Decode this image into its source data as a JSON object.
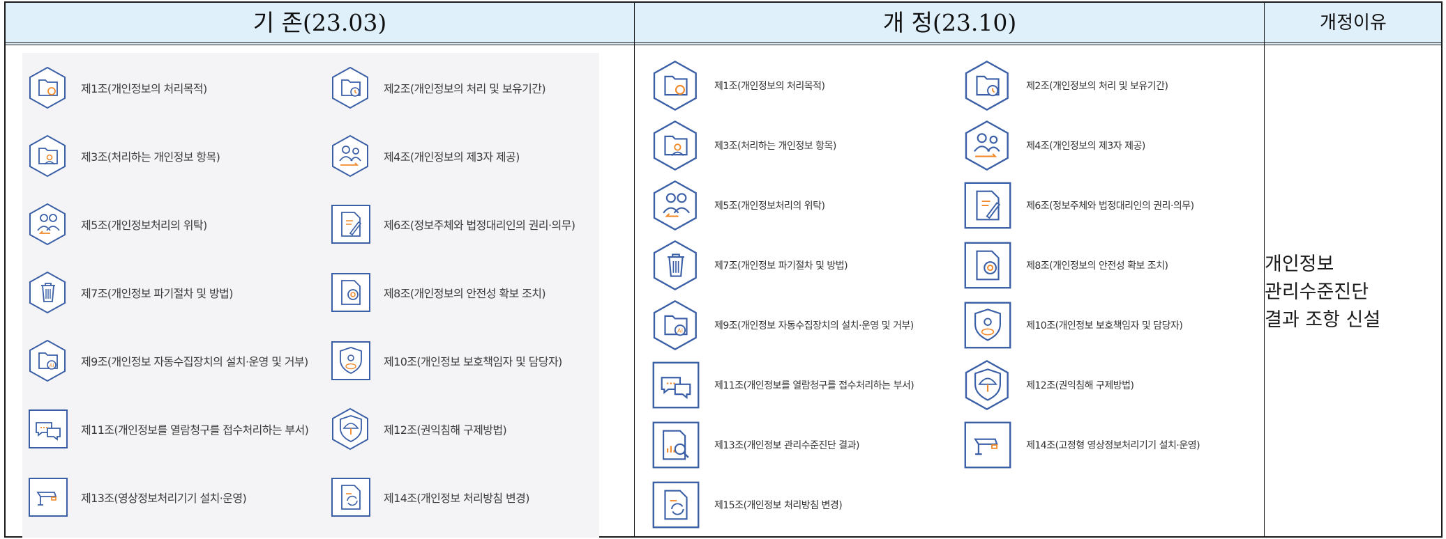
{
  "header": {
    "col_old": "기  존(23.03)",
    "col_new": "개  정(23.10)",
    "col_reason": "개정이유"
  },
  "old_items": [
    {
      "label": "제1조(개인정보의 처리목적)",
      "icon": "folder-gear-icon",
      "frame": "hex"
    },
    {
      "label": "제2조(개인정보의 처리 및 보유기간)",
      "icon": "folder-clock-icon",
      "frame": "hex"
    },
    {
      "label": "제3조(처리하는 개인정보 항목)",
      "icon": "folder-person-icon",
      "frame": "hex"
    },
    {
      "label": "제4조(개인정보의 제3자 제공)",
      "icon": "people-transfer-icon",
      "frame": "hex"
    },
    {
      "label": "제5조(개인정보처리의 위탁)",
      "icon": "people-return-icon",
      "frame": "hex"
    },
    {
      "label": "제6조(정보주체와 법정대리인의 권리·의무)",
      "icon": "document-pen-icon",
      "frame": "square"
    },
    {
      "label": "제7조(개인정보 파기절차 및 방법)",
      "icon": "trash-icon",
      "frame": "hex"
    },
    {
      "label": "제8조(개인정보의 안전성 확보 조치)",
      "icon": "document-gear-icon",
      "frame": "square"
    },
    {
      "label": "제9조(개인정보 자동수집장치의 설치·운영 및 거부)",
      "icon": "folder-ai-icon",
      "frame": "hex"
    },
    {
      "label": "제10조(개인정보 보호책임자 및 담당자)",
      "icon": "cpo-shield-icon",
      "frame": "square"
    },
    {
      "label": "제11조(개인정보를 열람청구를 접수처리하는 부서)",
      "icon": "chat-bubbles-icon",
      "frame": "square"
    },
    {
      "label": "제12조(권익침해 구제방법)",
      "icon": "umbrella-shield-icon",
      "frame": "hex"
    },
    {
      "label": "제13조(영상정보처리기기 설치·운영)",
      "icon": "cctv-icon",
      "frame": "square"
    },
    {
      "label": "제14조(개인정보 처리방침 변경)",
      "icon": "document-refresh-icon",
      "frame": "square"
    }
  ],
  "new_items": [
    {
      "label": "제1조(개인정보의 처리목적)",
      "icon": "folder-gear-icon",
      "frame": "hex"
    },
    {
      "label": "제2조(개인정보의 처리 및 보유기간)",
      "icon": "folder-clock-icon",
      "frame": "hex"
    },
    {
      "label": "제3조(처리하는 개인정보 항목)",
      "icon": "folder-person-icon",
      "frame": "hex"
    },
    {
      "label": "제4조(개인정보의 제3자 제공)",
      "icon": "people-transfer-icon",
      "frame": "hex"
    },
    {
      "label": "제5조(개인정보처리의 위탁)",
      "icon": "people-return-icon",
      "frame": "hex"
    },
    {
      "label": "제6조(정보주체와 법정대리인의 권리·의무)",
      "icon": "document-pen-icon",
      "frame": "square"
    },
    {
      "label": "제7조(개인정보 파기절차 및 방법)",
      "icon": "trash-icon",
      "frame": "hex"
    },
    {
      "label": "제8조(개인정보의 안전성 확보 조치)",
      "icon": "document-gear-icon",
      "frame": "square"
    },
    {
      "label": "제9조(개인정보 자동수집장치의 설치·운영 및 거부)",
      "icon": "folder-ai-icon",
      "frame": "hex"
    },
    {
      "label": "제10조(개인정보 보호책임자 및 담당자)",
      "icon": "cpo-shield-icon",
      "frame": "square"
    },
    {
      "label": "제11조(개인정보를 열람청구를 접수처리하는 부서)",
      "icon": "chat-bubbles-icon",
      "frame": "square"
    },
    {
      "label": "제12조(권익침해 구제방법)",
      "icon": "umbrella-shield-icon",
      "frame": "hex"
    },
    {
      "label": "제13조(개인정보 관리수준진단 결과)",
      "icon": "report-magnifier-icon",
      "frame": "square"
    },
    {
      "label": "제14조(고정형 영상정보처리기기 설치·운영)",
      "icon": "cctv-icon",
      "frame": "square"
    },
    {
      "label": "제15조(개인정보 처리방침 변경)",
      "icon": "document-refresh-icon",
      "frame": "square"
    }
  ],
  "reason_lines": [
    "개인정보",
    "관리수준진단",
    "결과 조항 신설"
  ],
  "colors": {
    "icon_stroke": "#3a5fa6",
    "icon_accent": "#f08a2b",
    "header_bg": "#dff0fb",
    "old_panel_bg": "#f4f4f6"
  }
}
